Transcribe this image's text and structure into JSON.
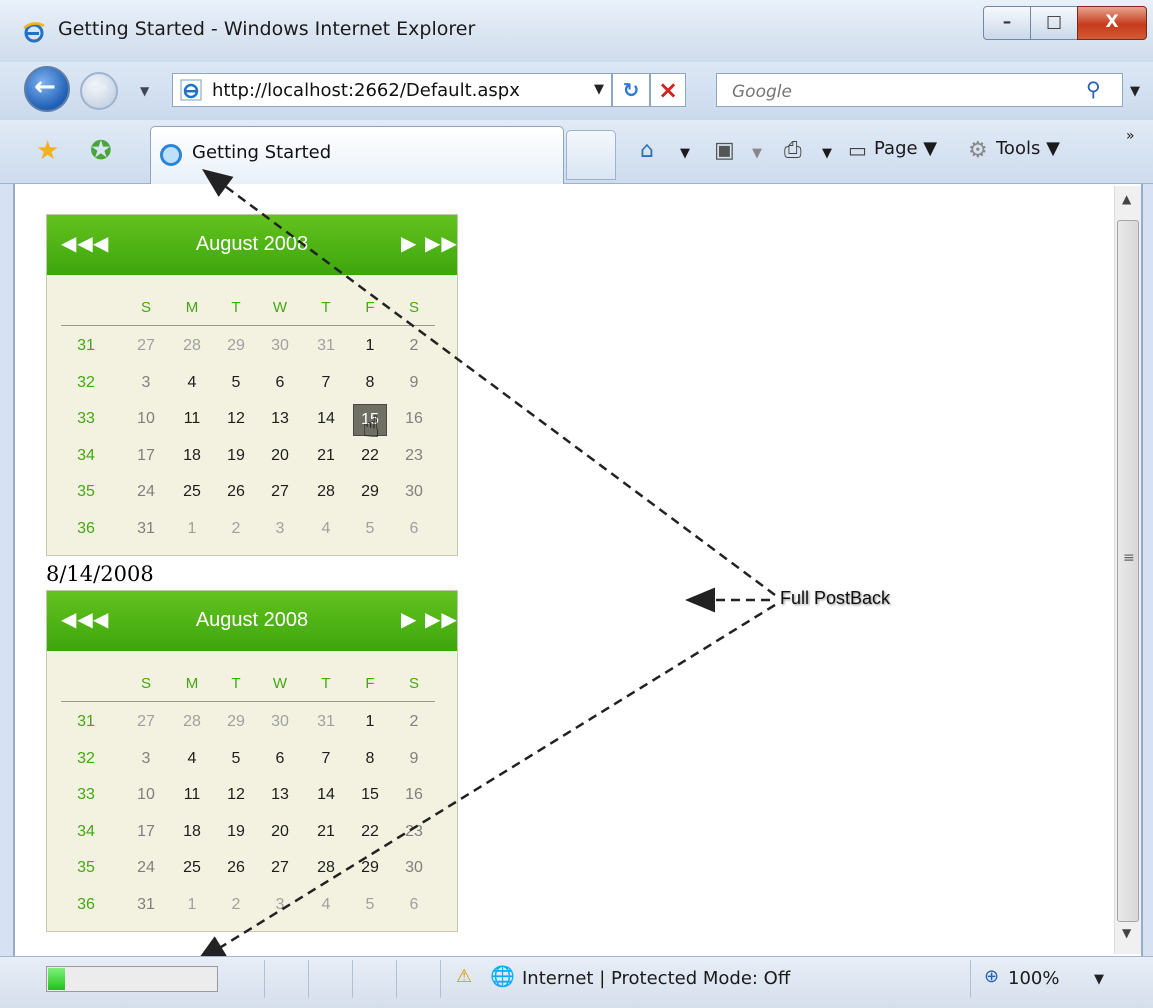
{
  "window": {
    "title": "Getting Started - Windows Internet Explorer",
    "controls": {
      "minimize": "–",
      "maximize": "□",
      "close": "X"
    }
  },
  "address_bar": {
    "url": "http://localhost:2662/Default.aspx",
    "search_placeholder": "Google"
  },
  "tab": {
    "label": "Getting Started"
  },
  "command_bar": {
    "page_label": "Page",
    "tools_label": "Tools"
  },
  "calendars": [
    {
      "title": "August 2008",
      "days_of_week": [
        "S",
        "M",
        "T",
        "W",
        "T",
        "F",
        "S"
      ],
      "weeks": [
        {
          "wk": "31",
          "days": [
            "27",
            "28",
            "29",
            "30",
            "31",
            "1",
            "2"
          ]
        },
        {
          "wk": "32",
          "days": [
            "3",
            "4",
            "5",
            "6",
            "7",
            "8",
            "9"
          ]
        },
        {
          "wk": "33",
          "days": [
            "10",
            "11",
            "12",
            "13",
            "14",
            "15",
            "16"
          ]
        },
        {
          "wk": "34",
          "days": [
            "17",
            "18",
            "19",
            "20",
            "21",
            "22",
            "23"
          ]
        },
        {
          "wk": "35",
          "days": [
            "24",
            "25",
            "26",
            "27",
            "28",
            "29",
            "30"
          ]
        },
        {
          "wk": "36",
          "days": [
            "31",
            "1",
            "2",
            "3",
            "4",
            "5",
            "6"
          ]
        }
      ],
      "selected": "15"
    },
    {
      "title": "August 2008",
      "days_of_week": [
        "S",
        "M",
        "T",
        "W",
        "T",
        "F",
        "S"
      ],
      "weeks": [
        {
          "wk": "31",
          "days": [
            "27",
            "28",
            "29",
            "30",
            "31",
            "1",
            "2"
          ]
        },
        {
          "wk": "32",
          "days": [
            "3",
            "4",
            "5",
            "6",
            "7",
            "8",
            "9"
          ]
        },
        {
          "wk": "33",
          "days": [
            "10",
            "11",
            "12",
            "13",
            "14",
            "15",
            "16"
          ]
        },
        {
          "wk": "34",
          "days": [
            "17",
            "18",
            "19",
            "20",
            "21",
            "22",
            "23"
          ]
        },
        {
          "wk": "35",
          "days": [
            "24",
            "25",
            "26",
            "27",
            "28",
            "29",
            "30"
          ]
        },
        {
          "wk": "36",
          "days": [
            "31",
            "1",
            "2",
            "3",
            "4",
            "5",
            "6"
          ]
        }
      ]
    }
  ],
  "selected_date_label": "8/14/2008",
  "annotation": "Full PostBack",
  "status_bar": {
    "progress_fraction": 0.1,
    "zone_text": "Internet | Protected Mode: Off",
    "zoom": "100%"
  }
}
